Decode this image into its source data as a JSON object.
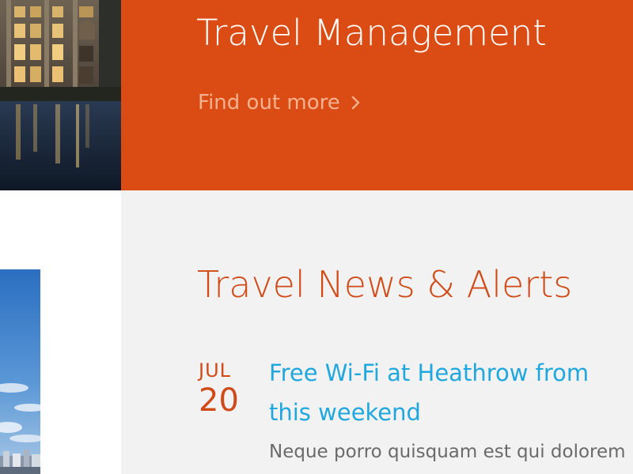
{
  "banner": {
    "title": "Travel Management",
    "link_label": "Find out more",
    "link_icon": "chevron-right-icon",
    "background_color": "#db4c14"
  },
  "news": {
    "title": "Travel News & Alerts",
    "items": [
      {
        "month": "JUL",
        "day": "20",
        "headline": "Free Wi-Fi at Heathrow from this weekend",
        "excerpt": "Neque porro quisquam est qui dolorem"
      }
    ]
  },
  "colors": {
    "accent_orange": "#d04a17",
    "link_blue": "#1fa7de",
    "panel_gray": "#f2f2f2"
  }
}
